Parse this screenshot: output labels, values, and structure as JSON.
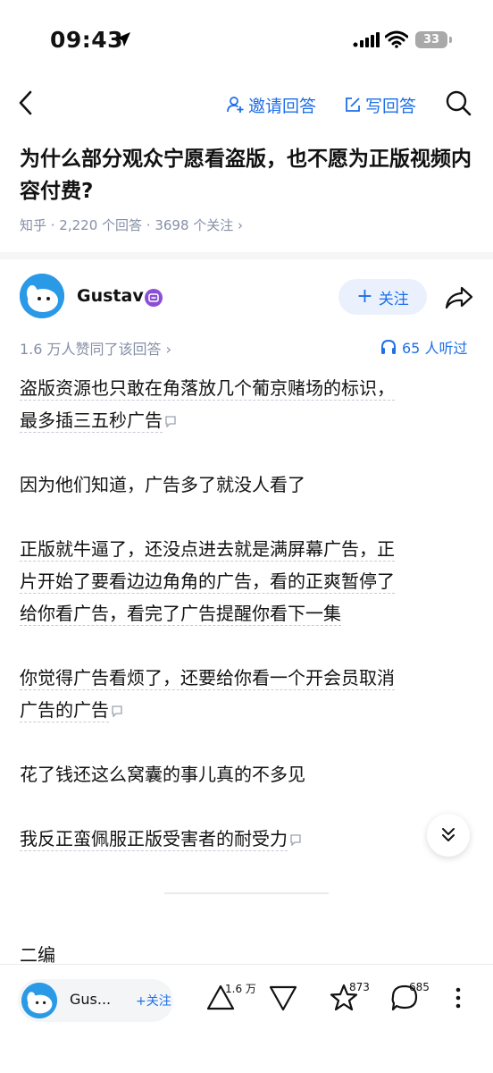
{
  "status_bar": {
    "time": "09:43",
    "battery": "33"
  },
  "nav": {
    "invite_label": "邀请回答",
    "write_label": "写回答"
  },
  "question": {
    "title": "为什么部分观众宁愿看盗版，也不愿为正版视频内容付费?",
    "meta": "知乎 · 2,220 个回答 · 3698 个关注 ›"
  },
  "author": {
    "name": "Gustav",
    "follow_label": "关注"
  },
  "answer_meta": {
    "likes": "1.6 万人赞同了该回答 ›",
    "listen": "65 人听过"
  },
  "content": {
    "p1_line1": "盗版资源也只敢在角落放几个葡京赌场的标识，",
    "p1_line2": "最多插三五秒广告",
    "p2": "因为他们知道，广告多了就没人看了",
    "p3_line1": "正版就牛逼了，还没点进去就是满屏幕广告，正",
    "p3_line2": "片开始了要看边边角角的广告，看的正爽暂停了",
    "p3_line3": "给你看广告，看完了广告提醒你看下一集",
    "p4_line1": "你觉得广告看烦了，还要给你看一个开会员取消",
    "p4_line2": "广告的广告",
    "p5": "花了钱还这么窝囊的事儿真的不多见",
    "p6": "我反正蛮佩服正版受害者的耐受力",
    "edit_heading": "二编"
  },
  "bottom_bar": {
    "author_short": "Gus...",
    "follow_label": "+关注",
    "upvotes": "1.6 万",
    "favorites": "873",
    "comments": "685"
  },
  "colors": {
    "accent": "#1e6fe8",
    "meta_gray": "#8590a6"
  }
}
